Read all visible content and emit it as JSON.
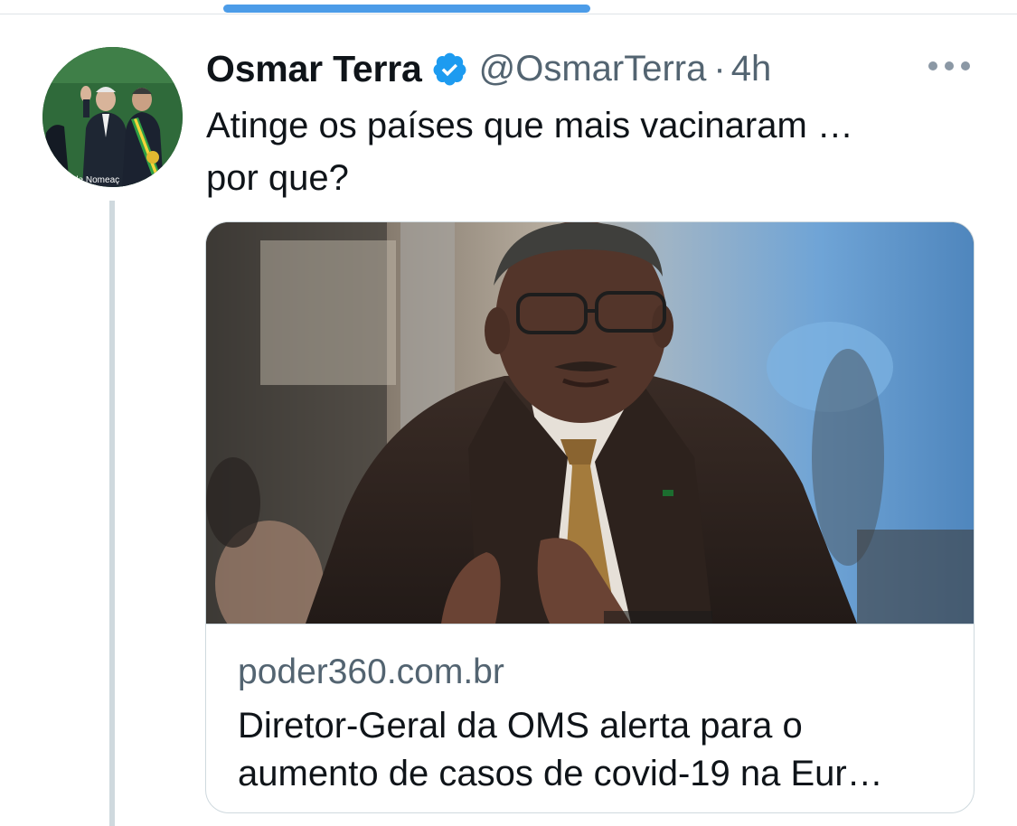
{
  "tweet": {
    "display_name": "Osmar Terra",
    "verified_icon": "verified-badge-icon",
    "handle": "@OsmarTerra",
    "separator": "·",
    "time": "4h",
    "text": "Atinge os países que mais vacinaram …\npor que?",
    "more_icon": "more-options-icon",
    "avatar_caption": "de Nomeaç"
  },
  "card": {
    "domain": "poder360.com.br",
    "title_line1": "Diretor-Geral da OMS alerta para o",
    "title_line2": "aumento de casos de covid-19 na Eur…"
  },
  "colors": {
    "accent": "#1d9bf0",
    "scroll_indicator": "#4c9ce8",
    "text_primary": "#0f1419",
    "text_secondary": "#536471",
    "border": "#cfd9de"
  }
}
